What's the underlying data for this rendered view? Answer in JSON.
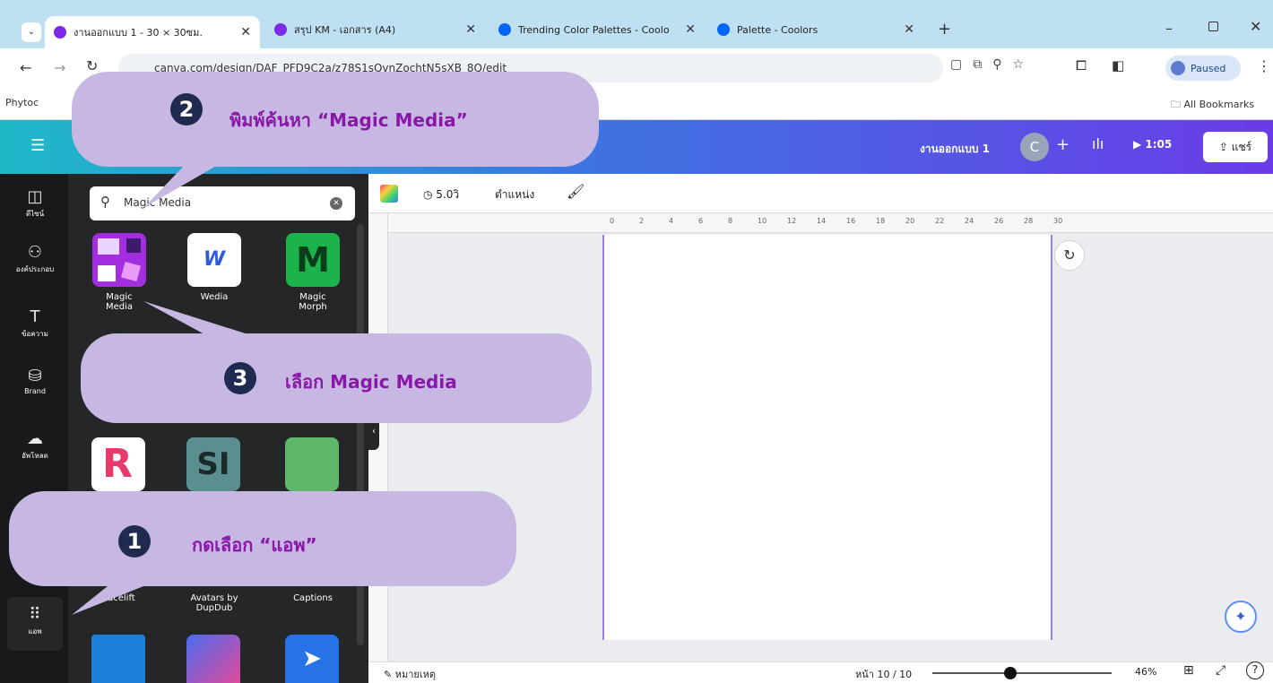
{
  "browser": {
    "tabs": [
      {
        "title": "งานออกแบบ 1 - 30 × 30ซม.",
        "active": true,
        "icon": "canva-icon"
      },
      {
        "title": "สรุป KM - เอกสาร (A4)",
        "active": false,
        "icon": "canva-icon"
      },
      {
        "title": "Trending Color Palettes - Coolo",
        "active": false,
        "icon": "coolors-icon"
      },
      {
        "title": "Palette - Coolors",
        "active": false,
        "icon": "coolors-icon"
      }
    ],
    "url": "canva.com/design/DAF_PFD9C2a/z78S1sQvnZochtN5sXB_8Q/edit",
    "profile_status": "Paused",
    "bookmark_first": "Phytoc",
    "all_bookmarks": "All Bookmarks"
  },
  "canva": {
    "design_name": "งานออกแบบ 1",
    "avatar_letter": "C",
    "timer": "1:05",
    "share_label": "แชร์",
    "rail": [
      {
        "label": "ดีไซน์",
        "icon": "template-icon"
      },
      {
        "label": "องค์ประกอบ",
        "icon": "elements-icon"
      },
      {
        "label": "ข้อความ",
        "icon": "text-icon"
      },
      {
        "label": "Brand",
        "icon": "brand-icon"
      },
      {
        "label": "อัพโหลด",
        "icon": "upload-icon"
      },
      {
        "label": "แอพ",
        "icon": "apps-icon"
      }
    ],
    "search_value": "Magic Media",
    "apps_row1": [
      {
        "name": "Magic Media"
      },
      {
        "name": "Wedia"
      },
      {
        "name": "Magic Morph"
      }
    ],
    "apps_row_bottom": [
      {
        "name": "Facelift"
      },
      {
        "name": "Avatars by DupDub"
      },
      {
        "name": "Captions"
      }
    ],
    "toolbar": {
      "duration": "5.0วิ",
      "position": "ตำแหน่ง"
    },
    "footer": {
      "notes": "หมายเหตุ",
      "page_indicator": "หน้า 10 / 10",
      "zoom": "46%"
    },
    "ruler_ticks": [
      "0",
      "2",
      "4",
      "6",
      "8",
      "10",
      "12",
      "14",
      "16",
      "18",
      "20",
      "22",
      "24",
      "26",
      "28",
      "30"
    ]
  },
  "callouts": [
    {
      "number": "1",
      "text": "กดเลือก “แอพ”"
    },
    {
      "number": "2",
      "text": "พิมพ์ค้นหา “Magic Media”"
    },
    {
      "number": "3",
      "text": "เลือก Magic Media"
    }
  ]
}
